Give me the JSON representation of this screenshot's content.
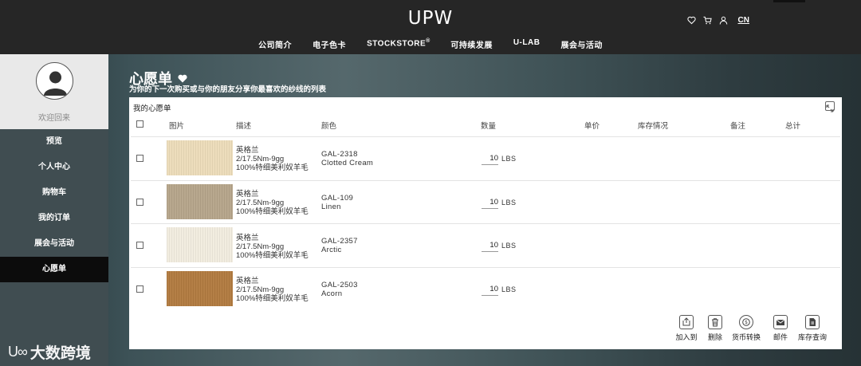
{
  "header": {
    "logo": "UPW",
    "nav": [
      "公司简介",
      "电子色卡",
      "STOCKSTORE",
      "可持续发展",
      "U-LAB",
      "展会与活动"
    ],
    "nav_sup": "®",
    "lang": "CN",
    "icons": [
      "heart-icon",
      "cart-icon",
      "user-icon"
    ]
  },
  "sidebar": {
    "welcome": "欢迎回来",
    "items": [
      {
        "label": "预览"
      },
      {
        "label": "个人中心"
      },
      {
        "label": "购物车"
      },
      {
        "label": "我的订单"
      },
      {
        "label": "展会与活动"
      },
      {
        "label": "心愿单",
        "active": true
      }
    ]
  },
  "page": {
    "title": "心愿单",
    "subtitle": "为你的下一次购买或与你的朋友分享你最喜欢的纱线的列表"
  },
  "wishlist": {
    "panel_title": "我的心愿单",
    "columns": [
      "图片",
      "描述",
      "颜色",
      "数量",
      "单价",
      "库存情况",
      "备注",
      "总计"
    ],
    "rows": [
      {
        "desc1": "英格兰",
        "desc2": "2/17.5Nm-9gg",
        "desc3": "100%特细美利奴羊毛",
        "code": "GAL-2318",
        "color_name": "Clotted Cream",
        "qty": "10",
        "unit": "LBS",
        "swatch": "#ecdcb9"
      },
      {
        "desc1": "英格兰",
        "desc2": "2/17.5Nm-9gg",
        "desc3": "100%特细美利奴羊毛",
        "code": "GAL-109",
        "color_name": "Linen",
        "qty": "10",
        "unit": "LBS",
        "swatch": "#b5a48a"
      },
      {
        "desc1": "英格兰",
        "desc2": "2/17.5Nm-9gg",
        "desc3": "100%特细美利奴羊毛",
        "code": "GAL-2357",
        "color_name": "Arctic",
        "qty": "10",
        "unit": "LBS",
        "swatch": "#f1ecdf"
      },
      {
        "desc1": "英格兰",
        "desc2": "2/17.5Nm-9gg",
        "desc3": "100%特细美利奴羊毛",
        "code": "GAL-2503",
        "color_name": "Acorn",
        "qty": "10",
        "unit": "LBS",
        "swatch": "#b17a3f"
      }
    ],
    "actions": [
      "加入到",
      "删除",
      "货币转换",
      "邮件",
      "库存查询"
    ]
  },
  "watermark": {
    "mark": "U∞",
    "text": "大数跨境"
  },
  "colors": {
    "header_bg": "#262626",
    "sidebar_bg": "#404d51",
    "active_item": "#0c0c0c"
  }
}
